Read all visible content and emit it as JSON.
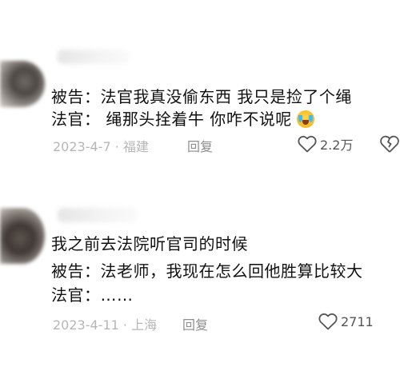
{
  "comments": [
    {
      "lines": [
        "被告：法官我真没偷东西  我只是捡了个绳",
        "法官：  绳那头拴着牛  你咋不说呢"
      ],
      "emoji_icon": "laughing-crying-emoji-icon",
      "meta": "2023-4-7 · 福建",
      "reply_label": "回复",
      "likes": "2.2万"
    },
    {
      "lines": [
        "我之前去法院听官司的时候",
        "被告：法老师，我现在怎么回他胜算比较大",
        "法官：……"
      ],
      "meta": "2023-4-11 · 上海",
      "reply_label": "回复",
      "likes": "2711"
    }
  ],
  "colors": {
    "text": "#111111",
    "meta": "#b6b6b6",
    "reply": "#8e8e8e",
    "icon": "#555555"
  }
}
